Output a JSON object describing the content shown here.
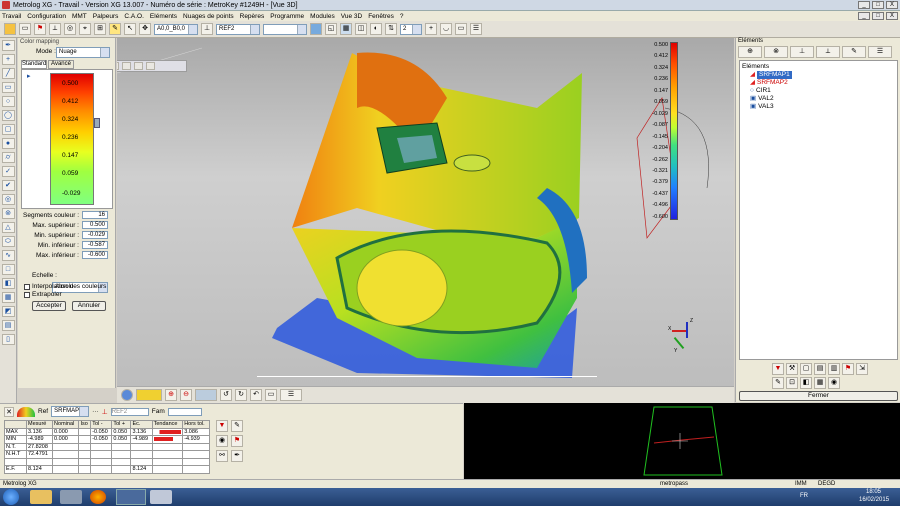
{
  "window": {
    "title": "Metrolog XG   - Travail - Version XG 13.007 - Numéro de série : MetroKey #1249H - [Vue 3D]",
    "controls": [
      "_",
      "□",
      "X"
    ]
  },
  "menu": [
    "Travail",
    "Configuration",
    "MMT",
    "Palpeurs",
    "C.A.O.",
    "Eléments",
    "Nuages de points",
    "Repères",
    "Programme",
    "Modules",
    "Vue 3D",
    "Fenêtres",
    "?"
  ],
  "toolbar": {
    "combo1": "A0,0_B0,0",
    "combo2": "REF2",
    "combo3": "2"
  },
  "color_mapping": {
    "title": "Color mapping",
    "mode_label": "Mode :",
    "mode_value": "Nuage",
    "tabs": [
      "Standard",
      "Avancé"
    ],
    "scale_labels": [
      "0.500",
      "0.412",
      "0.324",
      "0.236",
      "0.147",
      "0.059",
      "-0.029"
    ],
    "fields": [
      {
        "label": "Segments couleur :",
        "value": "16"
      },
      {
        "label": "Max. supérieur :",
        "value": "0.500"
      },
      {
        "label": "Min. supérieur :",
        "value": "-0.029"
      },
      {
        "label": "Min. inférieur :",
        "value": "-0.587"
      },
      {
        "label": "Max. inférieur :",
        "value": "-0.600"
      }
    ],
    "echelle_label": "Echelle :",
    "echelle_value": "Absolu",
    "interp_label": "Interpolation des couleurs",
    "extrap_label": "Extrapoler",
    "accept": "Accepter",
    "cancel": "Annuler"
  },
  "legend": {
    "values": [
      "0.500",
      "0.412",
      "0.324",
      "0.236",
      "0.147",
      "0.059",
      "-0.029",
      "-0.087",
      "-0.145",
      "-0.204",
      "-0.262",
      "-0.321",
      "-0.379",
      "-0.437",
      "-0.496",
      "-0.600"
    ]
  },
  "axes": {
    "x": "X",
    "y": "Y",
    "z": "Z"
  },
  "elements_panel": {
    "title": "Eléments",
    "root": "Eléments",
    "items": [
      "SRFMAP1",
      "SRFMAP2",
      "CIR1",
      "VAL2",
      "VAL3"
    ],
    "close": "Fermer"
  },
  "stats": {
    "element": "SRFMAP1",
    "ref_label": "Ref",
    "ref_value": "REF2",
    "fam_label": "Fam",
    "columns": [
      "Mesuré",
      "Nominal",
      "Iso",
      "Tol -",
      "Tol +",
      "Ec.",
      "Tendance",
      "Hors tol."
    ],
    "rows": [
      {
        "name": "MAX",
        "values": [
          "3.136",
          "0.000",
          "",
          "-0.050",
          "0.050",
          "3.136",
          "",
          "3.086"
        ]
      },
      {
        "name": "MIN",
        "values": [
          "-4.989",
          "0.000",
          "",
          "-0.050",
          "0.050",
          "-4.989",
          "",
          "-4.939"
        ]
      },
      {
        "name": "N.T.",
        "values": [
          "27.8208",
          "",
          "",
          "",
          "",
          "",
          "",
          ""
        ]
      },
      {
        "name": "N.H.T",
        "values": [
          "72.4791",
          "",
          "",
          "",
          "",
          "",
          "",
          ""
        ]
      },
      {
        "name": "",
        "values": [
          "",
          "",
          "",
          "",
          "",
          "",
          "",
          ""
        ]
      },
      {
        "name": "E.F.",
        "values": [
          "8.124",
          "",
          "",
          "",
          "",
          "8.124",
          "",
          ""
        ]
      }
    ]
  },
  "status": {
    "app": "Metrolog XG",
    "center": "metropass",
    "mode": "IMM",
    "units": "DEGD"
  },
  "taskbar": {
    "lang": "FR",
    "time": "18:05",
    "date": "16/02/2015"
  },
  "colors": {
    "accent": "#1a5fb4",
    "red": "#e02020",
    "selected": "#316ac5"
  }
}
